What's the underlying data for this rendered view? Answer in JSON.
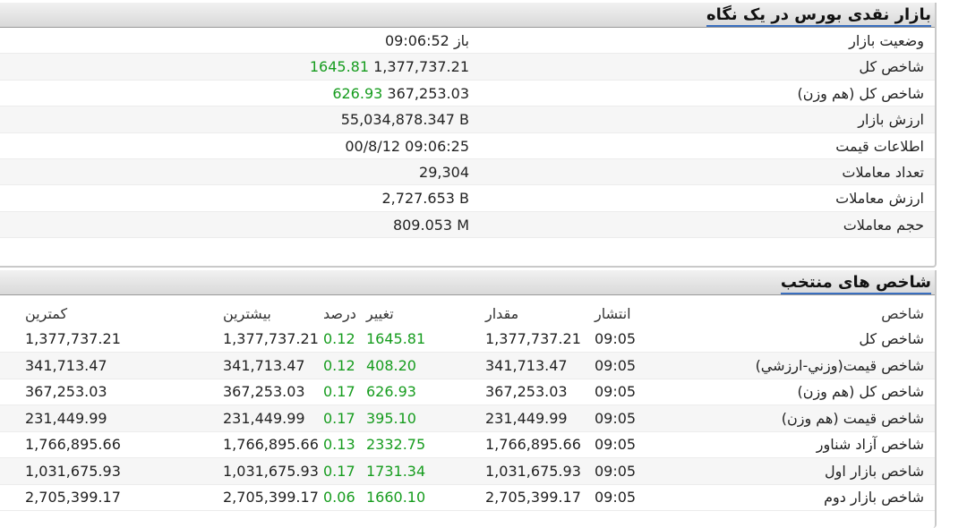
{
  "summary": {
    "title": "بازار نقدی بورس در یک نگاه",
    "rows": [
      {
        "label": "وضعیت بازار",
        "value": "باز 09:06:52",
        "extra": ""
      },
      {
        "label": "شاخص کل",
        "value": "1,377,737.21",
        "extra": "1645.81"
      },
      {
        "label": "شاخص کل (هم وزن)",
        "value": "367,253.03",
        "extra": "626.93"
      },
      {
        "label": "ارزش بازار",
        "value": "55,034,878.347 B",
        "extra": ""
      },
      {
        "label": "اطلاعات قیمت",
        "value": "00/8/12 09:06:25",
        "extra": ""
      },
      {
        "label": "تعداد معاملات",
        "value": "29,304",
        "extra": ""
      },
      {
        "label": "ارزش معاملات",
        "value": "2,727.653 B",
        "extra": ""
      },
      {
        "label": "حجم معاملات",
        "value": "809.053 M",
        "extra": ""
      }
    ]
  },
  "indices": {
    "title": "شاخص های منتخب",
    "headers": {
      "name": "شاخص",
      "time": "انتشار",
      "amount": "مقدار",
      "change": "تغییر",
      "percent": "درصد",
      "max": "بیشترین",
      "min": "کمترین"
    },
    "rows": [
      {
        "name": "شاخص كل",
        "time": "09:05",
        "amount": "1,377,737.21",
        "change": "1645.81",
        "percent": "0.12",
        "max": "1,377,737.21",
        "min": "1,377,737.21"
      },
      {
        "name": "شاخص قيمت(وزني-ارزشي)",
        "time": "09:05",
        "amount": "341,713.47",
        "change": "408.20",
        "percent": "0.12",
        "max": "341,713.47",
        "min": "341,713.47"
      },
      {
        "name": "شاخص كل (هم وزن)",
        "time": "09:05",
        "amount": "367,253.03",
        "change": "626.93",
        "percent": "0.17",
        "max": "367,253.03",
        "min": "367,253.03"
      },
      {
        "name": "شاخص قيمت (هم وزن)",
        "time": "09:05",
        "amount": "231,449.99",
        "change": "395.10",
        "percent": "0.17",
        "max": "231,449.99",
        "min": "231,449.99"
      },
      {
        "name": "شاخص آزاد شناور",
        "time": "09:05",
        "amount": "1,766,895.66",
        "change": "2332.75",
        "percent": "0.13",
        "max": "1,766,895.66",
        "min": "1,766,895.66"
      },
      {
        "name": "شاخص بازار اول",
        "time": "09:05",
        "amount": "1,031,675.93",
        "change": "1731.34",
        "percent": "0.17",
        "max": "1,031,675.93",
        "min": "1,031,675.93"
      },
      {
        "name": "شاخص بازار دوم",
        "time": "09:05",
        "amount": "2,705,399.17",
        "change": "1660.10",
        "percent": "0.06",
        "max": "2,705,399.17",
        "min": "2,705,399.17"
      }
    ]
  },
  "colors": {
    "positive": "#169c1e",
    "header_bg": "#e3e3e3",
    "title_underline": "#3a6fbf"
  }
}
